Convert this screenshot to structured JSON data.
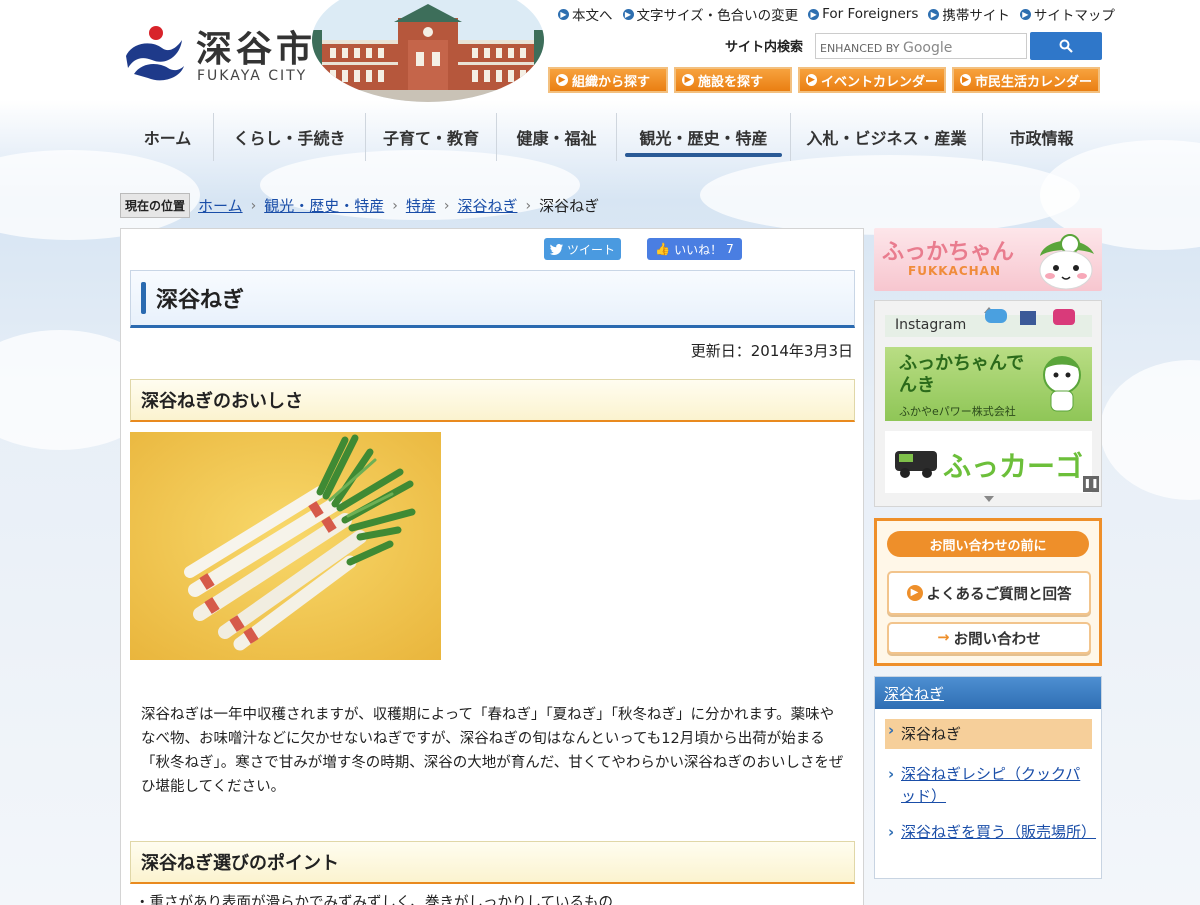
{
  "header": {
    "logo_jp": "深谷市",
    "logo_en": "FUKAYA CITY",
    "top_links": [
      "本文へ",
      "文字サイズ・色合いの変更",
      "For Foreigners",
      "携帯サイト",
      "サイトマップ"
    ],
    "search_label": "サイト内検索",
    "search_placeholder_prefix": "ENHANCED BY",
    "search_placeholder_brand": "Google",
    "quick_buttons": [
      "組織から探す",
      "施設を探す",
      "イベントカレンダー",
      "市民生活カレンダー"
    ]
  },
  "nav": {
    "items": [
      {
        "label": "ホーム",
        "active": false
      },
      {
        "label": "くらし・手続き",
        "active": false
      },
      {
        "label": "子育て・教育",
        "active": false
      },
      {
        "label": "健康・福祉",
        "active": false
      },
      {
        "label": "観光・歴史・特産",
        "active": true
      },
      {
        "label": "入札・ビジネス・産業",
        "active": false
      },
      {
        "label": "市政情報",
        "active": false
      }
    ]
  },
  "breadcrumb": {
    "tag": "現在の位置",
    "links": [
      "ホーム",
      "観光・歴史・特産",
      "特産",
      "深谷ねぎ"
    ],
    "current": "深谷ねぎ"
  },
  "social": {
    "tweet": "ツイート",
    "like": "いいね！",
    "like_count": "7"
  },
  "main": {
    "title": "深谷ねぎ",
    "updated": "更新日：2014年3月3日",
    "section1": "深谷ねぎのおいしさ",
    "body": "深谷ねぎは一年中収穫されますが、収穫期によって「春ねぎ」「夏ねぎ」「秋冬ねぎ」に分かれます。薬味やなべ物、お味噌汁などに欠かせないねぎですが、深谷ねぎの旬はなんといっても12月頃から出荷が始まる「秋冬ねぎ」。寒さで甘みが増す冬の時期、深谷の大地が育んだ、甘くてやわらかい深谷ねぎのおいしさをぜひ堪能してください。",
    "section2": "深谷ねぎ選びのポイント",
    "bullet": "重さがあり表面が滑らかでみずみずしく、巻きがしっかりしているもの"
  },
  "sidebar": {
    "fukkachan_jp": "ふっかちゃん",
    "fukkachan_en": "FUKKACHAN",
    "slides": {
      "instagram": "Instagram",
      "denki_title": "ふっかちゃんでんき",
      "denki_company": "ふかやeパワー株式会社",
      "car": "ふっカーゴ"
    },
    "contact_head": "お問い合わせの前に",
    "contact_faq": "よくあるご質問と回答",
    "contact_inquiry": "お問い合わせ",
    "subnav_head": "深谷ねぎ",
    "subnav_items": [
      {
        "label": "深谷ねぎ",
        "current": true
      },
      {
        "label": "深谷ねぎレシピ（クックパッド）",
        "current": false
      },
      {
        "label": "深谷ねぎを買う（販売場所）",
        "current": false
      }
    ]
  },
  "colors": {
    "accent_blue": "#2a6ab0",
    "accent_orange": "#ee8f2a",
    "link": "#1a4ea8"
  }
}
